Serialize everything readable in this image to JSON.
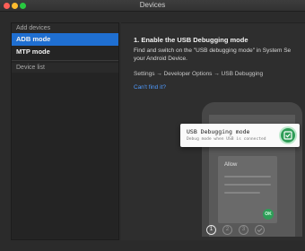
{
  "window": {
    "title": "Devices"
  },
  "sidebar": {
    "add_devices_header": "Add devices",
    "items": [
      {
        "label": "ADB mode",
        "active": true
      },
      {
        "label": "MTP mode",
        "active": false
      }
    ],
    "device_list_header": "Device list"
  },
  "main": {
    "step_title": "1. Enable the USB Debugging mode",
    "description": "Find and switch on the \"USB debugging mode\" in System Se\nyour Android Device.",
    "breadcrumb": "Settings → Developer Options → USB Debugging",
    "help_link": "Can't find it?"
  },
  "phone": {
    "dialog_text": "Allow",
    "ok_label": "OK",
    "popup_title": "USB Debugging mode",
    "popup_subtitle": "Debug mode when USB is connected",
    "toggle_on": true
  },
  "pager": {
    "steps": [
      "1",
      "2",
      "3"
    ],
    "current_index": 0,
    "final_icon": "check-icon"
  },
  "colors": {
    "accent": "#1f6fd1",
    "link": "#4f9bff",
    "toggle_green": "#2e9d57"
  }
}
